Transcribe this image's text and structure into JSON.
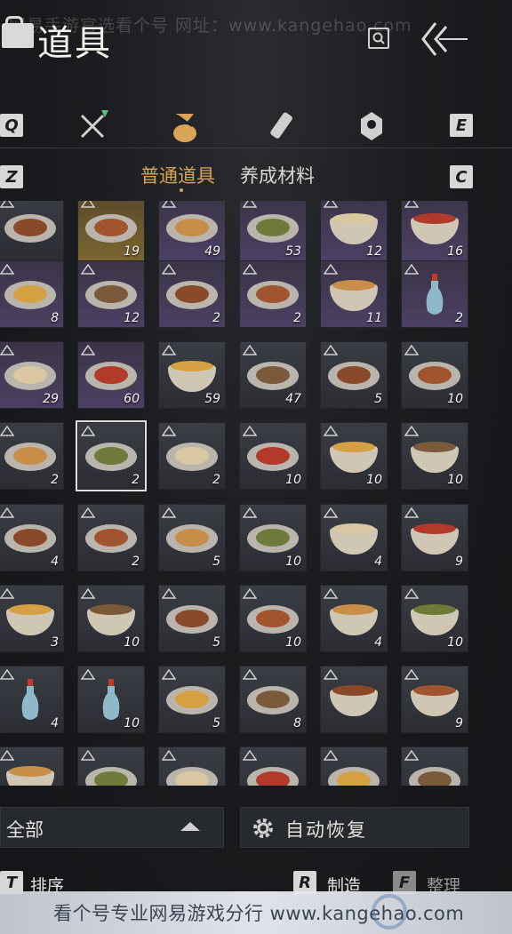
{
  "watermark": "网易手游官选看个号  网址：www.kangehao.com",
  "header": {
    "title": "道具"
  },
  "category_tabs": [
    {
      "name": "weapons",
      "icon": "crossed-swords-icon",
      "active": false
    },
    {
      "name": "bag",
      "icon": "pouch-icon",
      "active": true
    },
    {
      "name": "scroll",
      "icon": "scroll-icon",
      "active": false
    },
    {
      "name": "gem",
      "icon": "gem-icon",
      "active": false
    }
  ],
  "keys": {
    "prev_cat": "Q",
    "next_cat": "E",
    "prev_sub": "Z",
    "next_sub": "C",
    "sort": "T",
    "craft": "R",
    "tidy": "F"
  },
  "sub_tabs": {
    "active": "普通道具",
    "inactive": "养成材料"
  },
  "items": [
    [
      {
        "qty": "",
        "rarity": "plain",
        "icon": "letter-icon"
      },
      {
        "qty": "19",
        "rarity": "gold",
        "icon": "boat-icon"
      },
      {
        "qty": "49",
        "rarity": "purple",
        "icon": "jade-icon"
      },
      {
        "qty": "53",
        "rarity": "purple",
        "icon": "buns-icon"
      },
      {
        "qty": "12",
        "rarity": "purple",
        "icon": "stew-bowl-icon"
      },
      {
        "qty": "16",
        "rarity": "purple",
        "icon": "soup-bowl-icon"
      }
    ],
    [
      {
        "qty": "8",
        "rarity": "purple",
        "icon": "braised-dish-icon"
      },
      {
        "qty": "12",
        "rarity": "purple",
        "icon": "meat-dish-icon"
      },
      {
        "qty": "2",
        "rarity": "purple",
        "icon": "egg-dish-icon"
      },
      {
        "qty": "2",
        "rarity": "purple",
        "icon": "fish-dish-icon"
      },
      {
        "qty": "11",
        "rarity": "purple",
        "icon": "clay-pot-icon"
      },
      {
        "qty": "2",
        "rarity": "purple",
        "icon": "vase-icon"
      }
    ],
    [
      {
        "qty": "29",
        "rarity": "purple",
        "icon": "pork-dish-icon"
      },
      {
        "qty": "60",
        "rarity": "purple",
        "icon": "meatball-dish-icon"
      },
      {
        "qty": "59",
        "rarity": "plain",
        "icon": "tofu-pot-icon"
      },
      {
        "qty": "47",
        "rarity": "plain",
        "icon": "crab-dish-icon"
      },
      {
        "qty": "5",
        "rarity": "plain",
        "icon": "platter-icon"
      },
      {
        "qty": "10",
        "rarity": "plain",
        "icon": "shrimp-dish-icon"
      }
    ],
    [
      {
        "qty": "2",
        "rarity": "plain",
        "icon": "cake-dish-icon"
      },
      {
        "qty": "2",
        "rarity": "plain",
        "icon": "grilled-fish-icon",
        "selected": true
      },
      {
        "qty": "2",
        "rarity": "plain",
        "icon": "pancake-icon"
      },
      {
        "qty": "10",
        "rarity": "plain",
        "icon": "steamer-icon"
      },
      {
        "qty": "10",
        "rarity": "plain",
        "icon": "noodle-bowl-icon"
      },
      {
        "qty": "10",
        "rarity": "plain",
        "icon": "noodle-bowl-icon"
      }
    ],
    [
      {
        "qty": "4",
        "rarity": "plain",
        "icon": "sashimi-icon"
      },
      {
        "qty": "2",
        "rarity": "plain",
        "icon": "fried-dish-icon"
      },
      {
        "qty": "5",
        "rarity": "plain",
        "icon": "chicken-dish-icon"
      },
      {
        "qty": "10",
        "rarity": "plain",
        "icon": "greens-dish-icon"
      },
      {
        "qty": "4",
        "rarity": "plain",
        "icon": "tangyuan-bowl-icon"
      },
      {
        "qty": "9",
        "rarity": "plain",
        "icon": "soup-noodle-icon"
      }
    ],
    [
      {
        "qty": "3",
        "rarity": "plain",
        "icon": "porridge-bowl-icon"
      },
      {
        "qty": "10",
        "rarity": "plain",
        "icon": "bean-soup-icon"
      },
      {
        "qty": "5",
        "rarity": "plain",
        "icon": "tofu-dish-icon"
      },
      {
        "qty": "10",
        "rarity": "plain",
        "icon": "beef-dish-icon"
      },
      {
        "qty": "4",
        "rarity": "plain",
        "icon": "red-soup-icon"
      },
      {
        "qty": "10",
        "rarity": "plain",
        "icon": "rice-bowl-icon"
      }
    ],
    [
      {
        "qty": "4",
        "rarity": "plain",
        "icon": "vase-icon"
      },
      {
        "qty": "10",
        "rarity": "plain",
        "icon": "vase-icon"
      },
      {
        "qty": "5",
        "rarity": "plain",
        "icon": "noodle-dish-icon"
      },
      {
        "qty": "8",
        "rarity": "plain",
        "icon": "stirfry-dish-icon"
      },
      {
        "qty": "",
        "rarity": "plain",
        "icon": "fish-stew-icon"
      },
      {
        "qty": "9",
        "rarity": "plain",
        "icon": "spicy-bowl-icon"
      }
    ],
    [
      {
        "qty": "",
        "rarity": "plain",
        "icon": "pot-icon"
      },
      {
        "qty": "",
        "rarity": "plain",
        "icon": "meat-plate-icon"
      },
      {
        "qty": "",
        "rarity": "plain",
        "icon": "cake-plate-icon"
      },
      {
        "qty": "",
        "rarity": "plain",
        "icon": "egg-pile-icon"
      },
      {
        "qty": "",
        "rarity": "plain",
        "icon": "fried-pile-icon"
      },
      {
        "qty": "",
        "rarity": "plain",
        "icon": "corn-dish-icon"
      }
    ]
  ],
  "filter": {
    "label": "全部"
  },
  "auto_restore": {
    "label": "自动恢复"
  },
  "actions": {
    "sort": "排序",
    "craft": "制造",
    "tidy": "整理"
  },
  "footer": {
    "text": "看个号专业网易游戏分行  www.kangehao.com"
  },
  "colors": {
    "accent": "#d9a458",
    "purple_slot": "#4b4063",
    "gold_slot": "#7a6530"
  }
}
